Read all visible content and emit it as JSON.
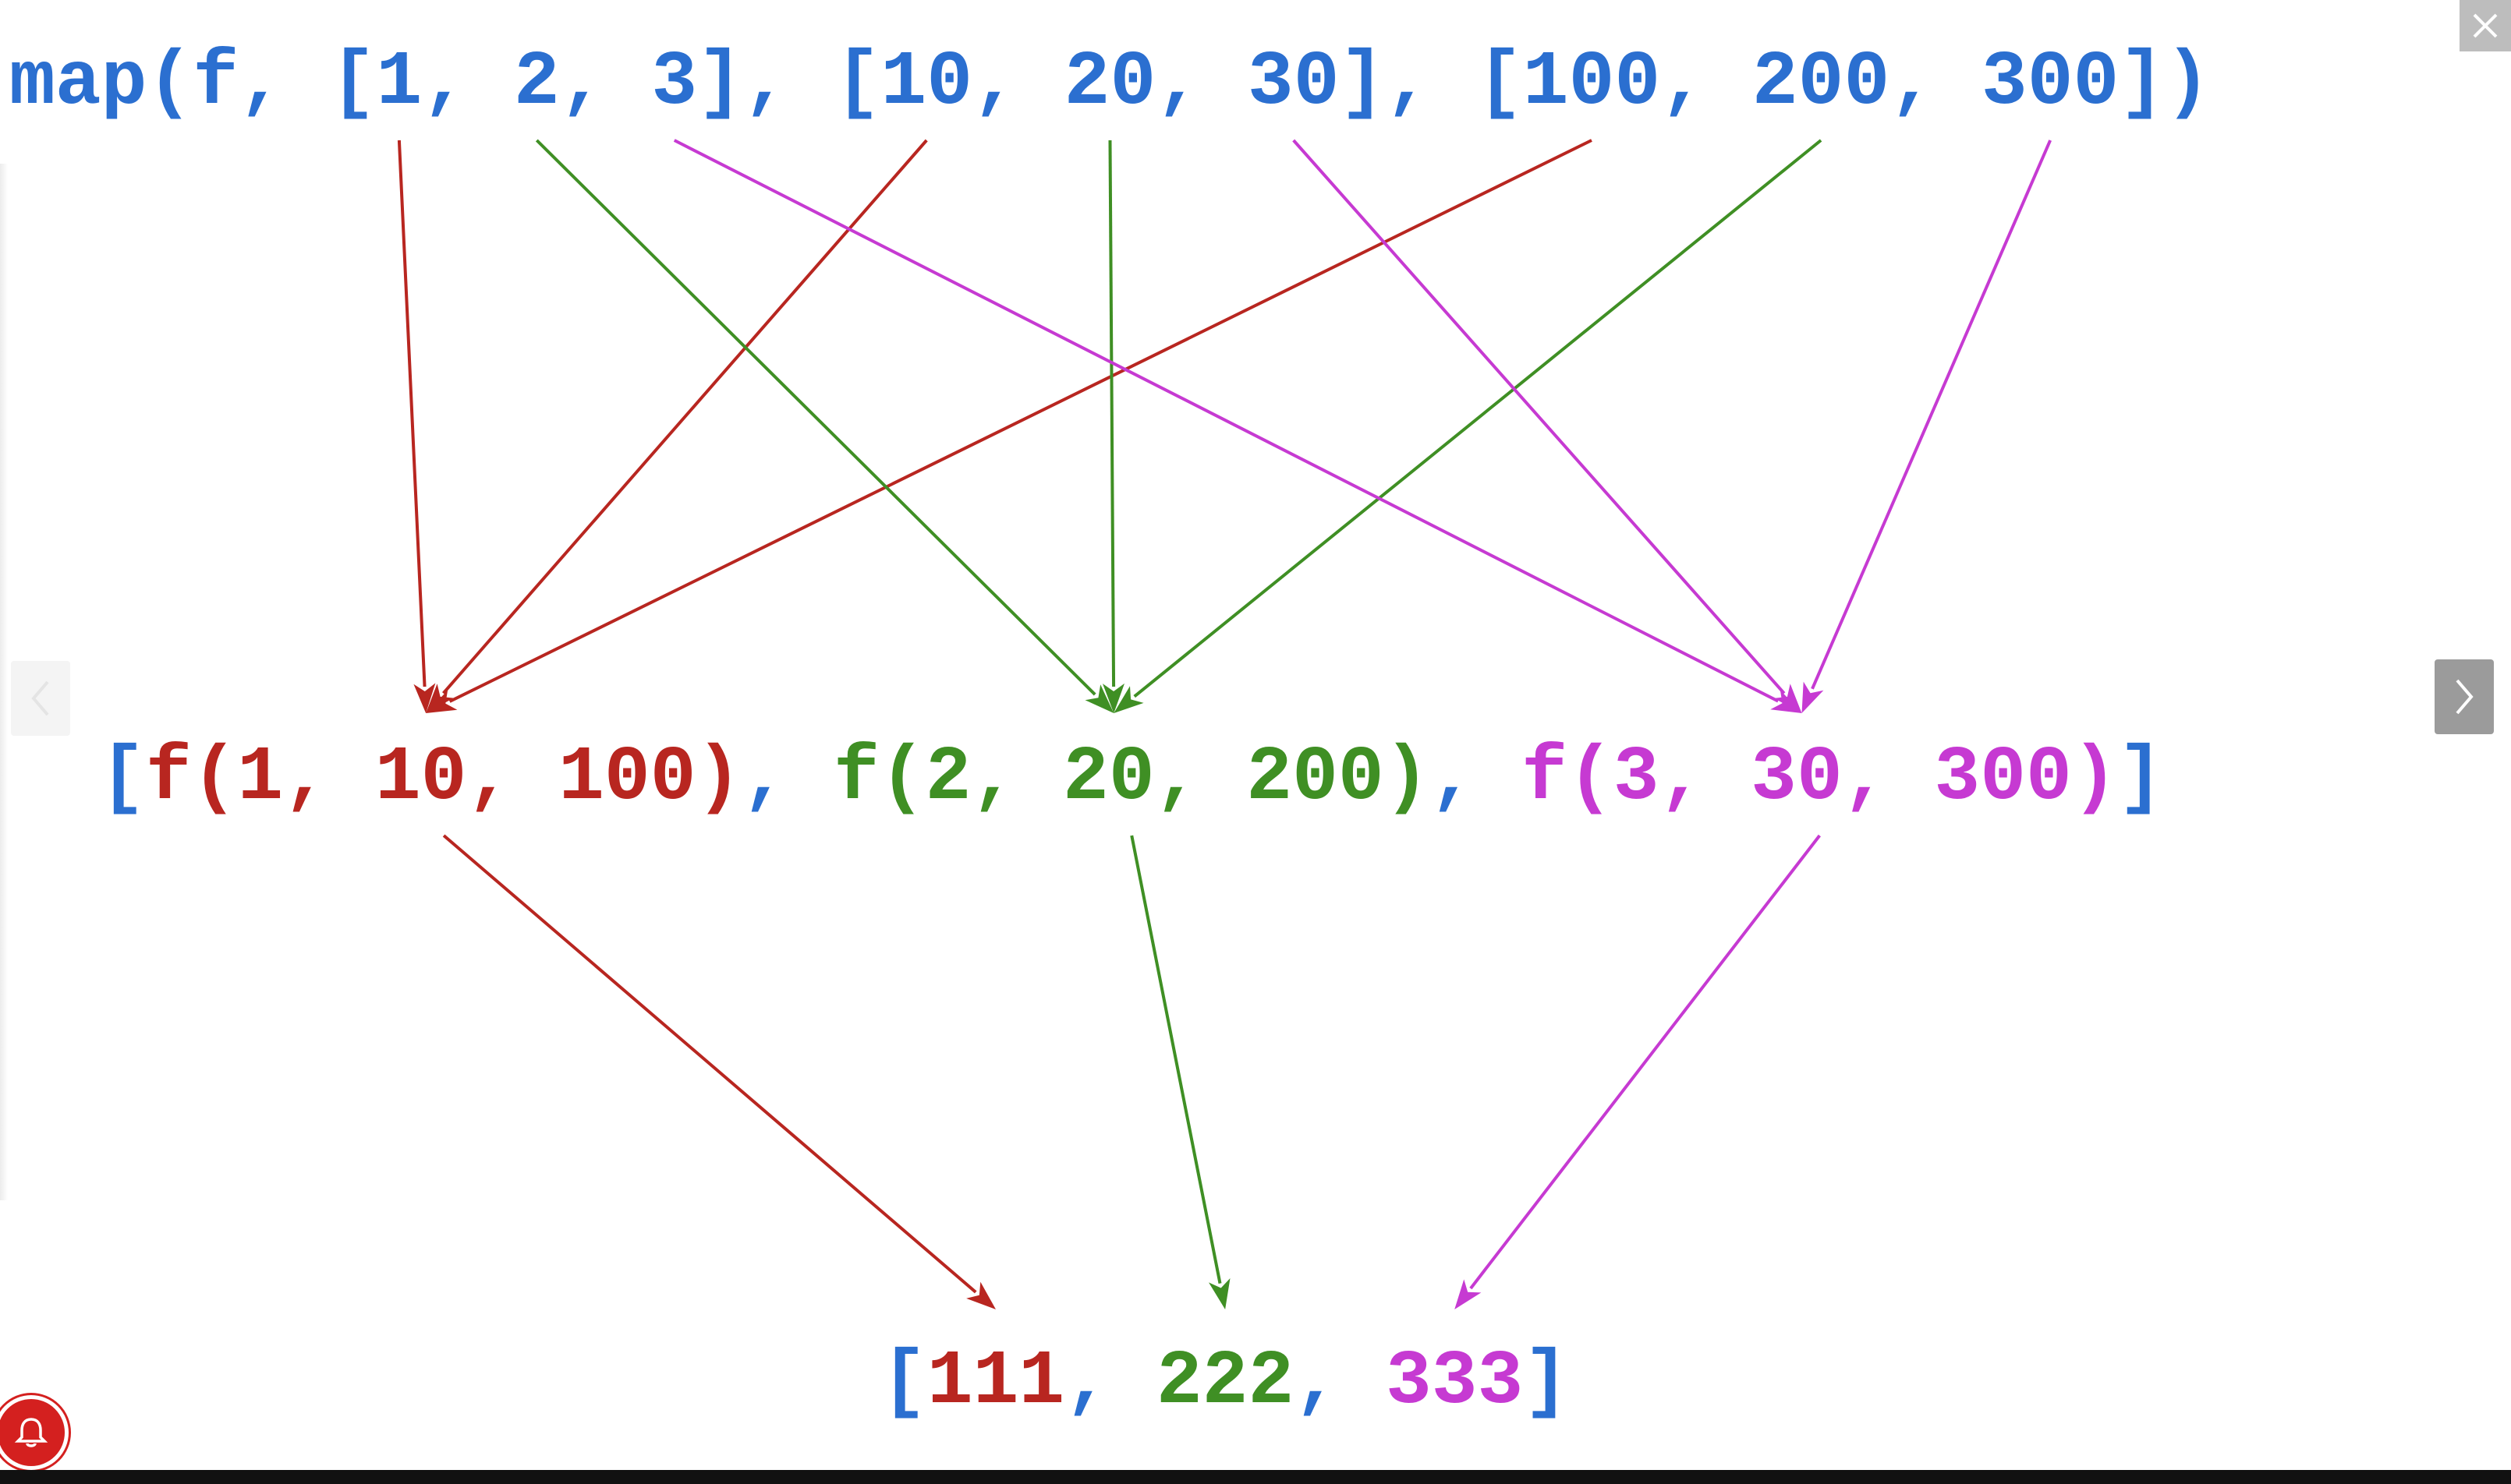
{
  "diagram": {
    "colors": {
      "blue": "#2b6fd0",
      "red": "#b82620",
      "green": "#3f8f24",
      "magenta": "#c63ad2"
    },
    "top_line": [
      {
        "text": "map(f, [",
        "color": "blue"
      },
      {
        "text": "1",
        "color": "blue"
      },
      {
        "text": ", ",
        "color": "blue"
      },
      {
        "text": "2",
        "color": "blue"
      },
      {
        "text": ", ",
        "color": "blue"
      },
      {
        "text": "3",
        "color": "blue"
      },
      {
        "text": "], [",
        "color": "blue"
      },
      {
        "text": "10",
        "color": "blue"
      },
      {
        "text": ", ",
        "color": "blue"
      },
      {
        "text": "20",
        "color": "blue"
      },
      {
        "text": ", ",
        "color": "blue"
      },
      {
        "text": "30",
        "color": "blue"
      },
      {
        "text": "], [",
        "color": "blue"
      },
      {
        "text": "100",
        "color": "blue"
      },
      {
        "text": ", ",
        "color": "blue"
      },
      {
        "text": "200",
        "color": "blue"
      },
      {
        "text": ", ",
        "color": "blue"
      },
      {
        "text": "300",
        "color": "blue"
      },
      {
        "text": "])",
        "color": "blue"
      }
    ],
    "middle_line": [
      {
        "text": "[",
        "color": "blue"
      },
      {
        "text": "f(1, 10, 100)",
        "color": "red"
      },
      {
        "text": ", ",
        "color": "blue"
      },
      {
        "text": "f(2, 20, 200)",
        "color": "green"
      },
      {
        "text": ", ",
        "color": "blue"
      },
      {
        "text": "f(3, 30, 300)",
        "color": "magenta"
      },
      {
        "text": "]",
        "color": "blue"
      }
    ],
    "bottom_line": [
      {
        "text": "[",
        "color": "blue"
      },
      {
        "text": "111",
        "color": "red"
      },
      {
        "text": ", ",
        "color": "blue"
      },
      {
        "text": "222",
        "color": "green"
      },
      {
        "text": ", ",
        "color": "blue"
      },
      {
        "text": "333",
        "color": "magenta"
      },
      {
        "text": "]",
        "color": "blue"
      }
    ],
    "edges": [
      {
        "from": "1",
        "to": "f(1, 10, 100)",
        "color": "red"
      },
      {
        "from": "10",
        "to": "f(1, 10, 100)",
        "color": "red"
      },
      {
        "from": "100",
        "to": "f(1, 10, 100)",
        "color": "red"
      },
      {
        "from": "2",
        "to": "f(2, 20, 200)",
        "color": "green"
      },
      {
        "from": "20",
        "to": "f(2, 20, 200)",
        "color": "green"
      },
      {
        "from": "200",
        "to": "f(2, 20, 200)",
        "color": "green"
      },
      {
        "from": "3",
        "to": "f(3, 30, 300)",
        "color": "magenta"
      },
      {
        "from": "30",
        "to": "f(3, 30, 300)",
        "color": "magenta"
      },
      {
        "from": "300",
        "to": "f(3, 30, 300)",
        "color": "magenta"
      },
      {
        "from": "f(1, 10, 100)",
        "to": "111",
        "color": "red"
      },
      {
        "from": "f(2, 20, 200)",
        "to": "222",
        "color": "green"
      },
      {
        "from": "f(3, 30, 300)",
        "to": "333",
        "color": "magenta"
      }
    ]
  },
  "viewer": {
    "prev_icon": "chevron-left-icon",
    "next_icon": "chevron-right-icon",
    "close_icon": "close-icon",
    "notify_icon": "bell-icon",
    "colors": {
      "nav_prev_bg": "#f4f4f4",
      "nav_next_bg": "#9b9b9b",
      "close_bg": "#bdbdbd",
      "notify_bg": "#d4201f"
    }
  }
}
